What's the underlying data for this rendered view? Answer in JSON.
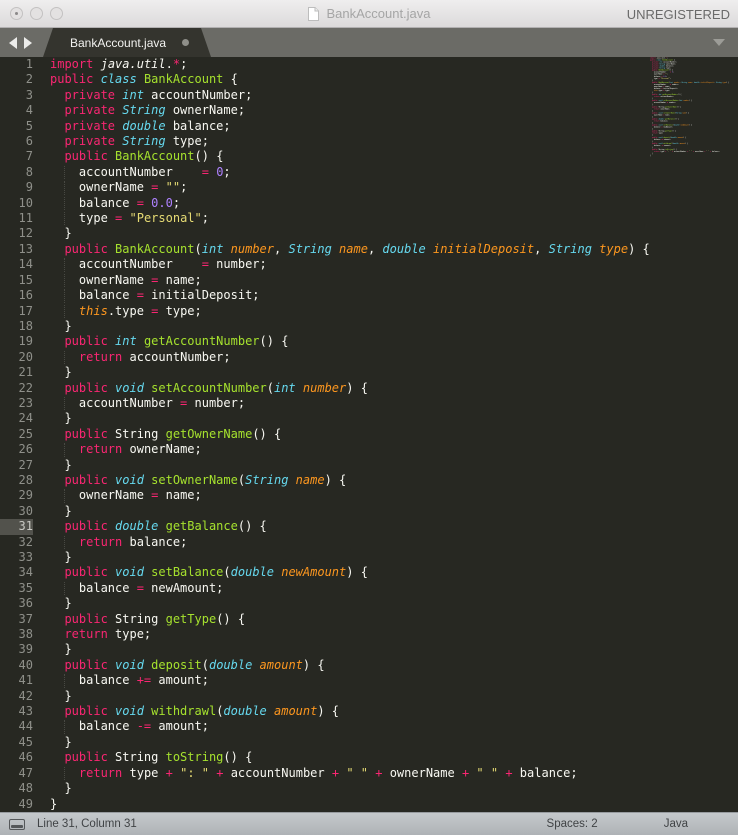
{
  "window": {
    "title": "BankAccount.java",
    "registration": "UNREGISTERED"
  },
  "tabbar": {
    "tabs": [
      {
        "label": "BankAccount.java",
        "modified": true
      }
    ]
  },
  "statusbar": {
    "position": "Line 31, Column 31",
    "indentation": "Spaces: 2",
    "syntax": "Java"
  },
  "colors": {
    "editor_background": "#272822",
    "keyword": "#f92672",
    "type": "#66d9ef",
    "function_name": "#a6e22e",
    "string": "#e6db74",
    "number": "#ae81ff",
    "parameter": "#fd971f",
    "plain_text": "#f8f8f2",
    "line_number": "#8f908a",
    "tabbar_background": "#6b6b66",
    "statusbar_background": "#b9bdc1"
  },
  "editor": {
    "language": "Java",
    "current_line": 31,
    "lines": [
      [
        [
          "k",
          "import"
        ],
        [
          "p",
          " "
        ],
        [
          "pi",
          "java.util"
        ],
        [
          "p",
          "."
        ],
        [
          "k",
          "*"
        ],
        [
          "p",
          ";"
        ]
      ],
      [
        [
          "k",
          "public "
        ],
        [
          "t",
          "class "
        ],
        [
          "f",
          "BankAccount"
        ],
        [
          "p",
          " {"
        ]
      ],
      [
        [
          "p",
          "  "
        ],
        [
          "k",
          "private "
        ],
        [
          "t",
          "int "
        ],
        [
          "p",
          "accountNumber;"
        ]
      ],
      [
        [
          "p",
          "  "
        ],
        [
          "k",
          "private "
        ],
        [
          "t",
          "String "
        ],
        [
          "p",
          "ownerName;"
        ]
      ],
      [
        [
          "p",
          "  "
        ],
        [
          "k",
          "private "
        ],
        [
          "t",
          "double "
        ],
        [
          "p",
          "balance;"
        ]
      ],
      [
        [
          "p",
          "  "
        ],
        [
          "k",
          "private "
        ],
        [
          "t",
          "String "
        ],
        [
          "p",
          "type;"
        ]
      ],
      [
        [
          "p",
          "  "
        ],
        [
          "k",
          "public "
        ],
        [
          "f",
          "BankAccount"
        ],
        [
          "p",
          "() {"
        ]
      ],
      [
        [
          "p",
          "    accountNumber    "
        ],
        [
          "k",
          "="
        ],
        [
          "p",
          " "
        ],
        [
          "n",
          "0"
        ],
        [
          "p",
          ";"
        ]
      ],
      [
        [
          "p",
          "    ownerName "
        ],
        [
          "k",
          "="
        ],
        [
          "p",
          " "
        ],
        [
          "s",
          "\"\""
        ],
        [
          "p",
          ";"
        ]
      ],
      [
        [
          "p",
          "    balance "
        ],
        [
          "k",
          "="
        ],
        [
          "p",
          " "
        ],
        [
          "n",
          "0.0"
        ],
        [
          "p",
          ";"
        ]
      ],
      [
        [
          "p",
          "    type "
        ],
        [
          "k",
          "="
        ],
        [
          "p",
          " "
        ],
        [
          "s",
          "\"Personal\""
        ],
        [
          "p",
          ";"
        ]
      ],
      [
        [
          "p",
          "  }"
        ]
      ],
      [
        [
          "p",
          "  "
        ],
        [
          "k",
          "public "
        ],
        [
          "f",
          "BankAccount"
        ],
        [
          "p",
          "("
        ],
        [
          "t",
          "int "
        ],
        [
          "a",
          "number"
        ],
        [
          "p",
          ", "
        ],
        [
          "t",
          "String "
        ],
        [
          "a",
          "name"
        ],
        [
          "p",
          ", "
        ],
        [
          "t",
          "double "
        ],
        [
          "a",
          "initialDeposit"
        ],
        [
          "p",
          ", "
        ],
        [
          "t",
          "String "
        ],
        [
          "a",
          "type"
        ],
        [
          "p",
          ") {"
        ]
      ],
      [
        [
          "p",
          "    accountNumber    "
        ],
        [
          "k",
          "="
        ],
        [
          "p",
          " number;"
        ]
      ],
      [
        [
          "p",
          "    ownerName "
        ],
        [
          "k",
          "="
        ],
        [
          "p",
          " name;"
        ]
      ],
      [
        [
          "p",
          "    balance "
        ],
        [
          "k",
          "="
        ],
        [
          "p",
          " initialDeposit;"
        ]
      ],
      [
        [
          "p",
          "    "
        ],
        [
          "a",
          "this"
        ],
        [
          "p",
          ".type "
        ],
        [
          "k",
          "="
        ],
        [
          "p",
          " type;"
        ]
      ],
      [
        [
          "p",
          "  }"
        ]
      ],
      [
        [
          "p",
          "  "
        ],
        [
          "k",
          "public "
        ],
        [
          "t",
          "int "
        ],
        [
          "f",
          "getAccountNumber"
        ],
        [
          "p",
          "() {"
        ]
      ],
      [
        [
          "p",
          "    "
        ],
        [
          "k",
          "return"
        ],
        [
          "p",
          " accountNumber;"
        ]
      ],
      [
        [
          "p",
          "  }"
        ]
      ],
      [
        [
          "p",
          "  "
        ],
        [
          "k",
          "public "
        ],
        [
          "t",
          "void "
        ],
        [
          "f",
          "setAccountNumber"
        ],
        [
          "p",
          "("
        ],
        [
          "t",
          "int "
        ],
        [
          "a",
          "number"
        ],
        [
          "p",
          ") {"
        ]
      ],
      [
        [
          "p",
          "    accountNumber "
        ],
        [
          "k",
          "="
        ],
        [
          "p",
          " number;"
        ]
      ],
      [
        [
          "p",
          "  }"
        ]
      ],
      [
        [
          "p",
          "  "
        ],
        [
          "k",
          "public "
        ],
        [
          "p",
          "String "
        ],
        [
          "f",
          "getOwnerName"
        ],
        [
          "p",
          "() {"
        ]
      ],
      [
        [
          "p",
          "    "
        ],
        [
          "k",
          "return"
        ],
        [
          "p",
          " ownerName;"
        ]
      ],
      [
        [
          "p",
          "  }"
        ]
      ],
      [
        [
          "p",
          "  "
        ],
        [
          "k",
          "public "
        ],
        [
          "t",
          "void "
        ],
        [
          "f",
          "setOwnerName"
        ],
        [
          "p",
          "("
        ],
        [
          "t",
          "String "
        ],
        [
          "a",
          "name"
        ],
        [
          "p",
          ") {"
        ]
      ],
      [
        [
          "p",
          "    ownerName "
        ],
        [
          "k",
          "="
        ],
        [
          "p",
          " name;"
        ]
      ],
      [
        [
          "p",
          "  }"
        ]
      ],
      [
        [
          "p",
          "  "
        ],
        [
          "k",
          "public "
        ],
        [
          "t",
          "double "
        ],
        [
          "f",
          "getBalance"
        ],
        [
          "p",
          "() {"
        ]
      ],
      [
        [
          "p",
          "    "
        ],
        [
          "k",
          "return"
        ],
        [
          "p",
          " balance;"
        ]
      ],
      [
        [
          "p",
          "  }"
        ]
      ],
      [
        [
          "p",
          "  "
        ],
        [
          "k",
          "public "
        ],
        [
          "t",
          "void "
        ],
        [
          "f",
          "setBalance"
        ],
        [
          "p",
          "("
        ],
        [
          "t",
          "double "
        ],
        [
          "a",
          "newAmount"
        ],
        [
          "p",
          ") {"
        ]
      ],
      [
        [
          "p",
          "    balance "
        ],
        [
          "k",
          "="
        ],
        [
          "p",
          " newAmount;"
        ]
      ],
      [
        [
          "p",
          "  }"
        ]
      ],
      [
        [
          "p",
          "  "
        ],
        [
          "k",
          "public "
        ],
        [
          "p",
          "String "
        ],
        [
          "f",
          "getType"
        ],
        [
          "p",
          "() {"
        ]
      ],
      [
        [
          "p",
          "  "
        ],
        [
          "k",
          "return"
        ],
        [
          "p",
          " type;"
        ]
      ],
      [
        [
          "p",
          "  }"
        ]
      ],
      [
        [
          "p",
          "  "
        ],
        [
          "k",
          "public "
        ],
        [
          "t",
          "void "
        ],
        [
          "f",
          "deposit"
        ],
        [
          "p",
          "("
        ],
        [
          "t",
          "double "
        ],
        [
          "a",
          "amount"
        ],
        [
          "p",
          ") {"
        ]
      ],
      [
        [
          "p",
          "    balance "
        ],
        [
          "k",
          "+="
        ],
        [
          "p",
          " amount;"
        ]
      ],
      [
        [
          "p",
          "  }"
        ]
      ],
      [
        [
          "p",
          "  "
        ],
        [
          "k",
          "public "
        ],
        [
          "t",
          "void "
        ],
        [
          "f",
          "withdrawl"
        ],
        [
          "p",
          "("
        ],
        [
          "t",
          "double "
        ],
        [
          "a",
          "amount"
        ],
        [
          "p",
          ") {"
        ]
      ],
      [
        [
          "p",
          "    balance "
        ],
        [
          "k",
          "-="
        ],
        [
          "p",
          " amount;"
        ]
      ],
      [
        [
          "p",
          "  }"
        ]
      ],
      [
        [
          "p",
          "  "
        ],
        [
          "k",
          "public "
        ],
        [
          "p",
          "String "
        ],
        [
          "f",
          "toString"
        ],
        [
          "p",
          "() {"
        ]
      ],
      [
        [
          "p",
          "    "
        ],
        [
          "k",
          "return"
        ],
        [
          "p",
          " type "
        ],
        [
          "k",
          "+"
        ],
        [
          "p",
          " "
        ],
        [
          "s",
          "\": \""
        ],
        [
          "p",
          " "
        ],
        [
          "k",
          "+"
        ],
        [
          "p",
          " accountNumber "
        ],
        [
          "k",
          "+"
        ],
        [
          "p",
          " "
        ],
        [
          "s",
          "\" \""
        ],
        [
          "p",
          " "
        ],
        [
          "k",
          "+"
        ],
        [
          "p",
          " ownerName "
        ],
        [
          "k",
          "+"
        ],
        [
          "p",
          " "
        ],
        [
          "s",
          "\" \""
        ],
        [
          "p",
          " "
        ],
        [
          "k",
          "+"
        ],
        [
          "p",
          " balance;"
        ]
      ],
      [
        [
          "p",
          "  }"
        ]
      ],
      [
        [
          "p",
          "}"
        ]
      ]
    ]
  }
}
